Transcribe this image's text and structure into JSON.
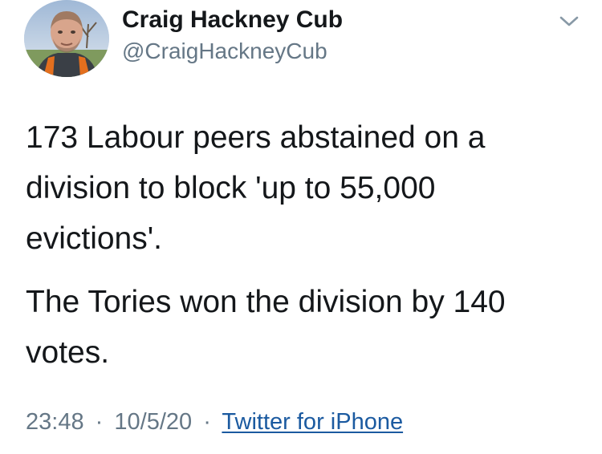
{
  "user": {
    "display_name": "Craig Hackney Cub",
    "handle": "@CraigHackneyCub"
  },
  "tweet": {
    "lines_para1": [
      "173 Labour peers abstained on a",
      "division to block 'up to 55,000",
      "evictions'."
    ],
    "lines_para2": [
      "The Tories won the division by 140",
      "votes."
    ]
  },
  "meta": {
    "time": "23:48",
    "separator": "·",
    "date": "10/5/20",
    "source": "Twitter for iPhone"
  },
  "icons": {
    "more": "chevron-down-icon",
    "avatar": "profile-photo"
  },
  "colors": {
    "text": "#14171a",
    "secondary": "#657786",
    "link": "#1b5aa0"
  }
}
